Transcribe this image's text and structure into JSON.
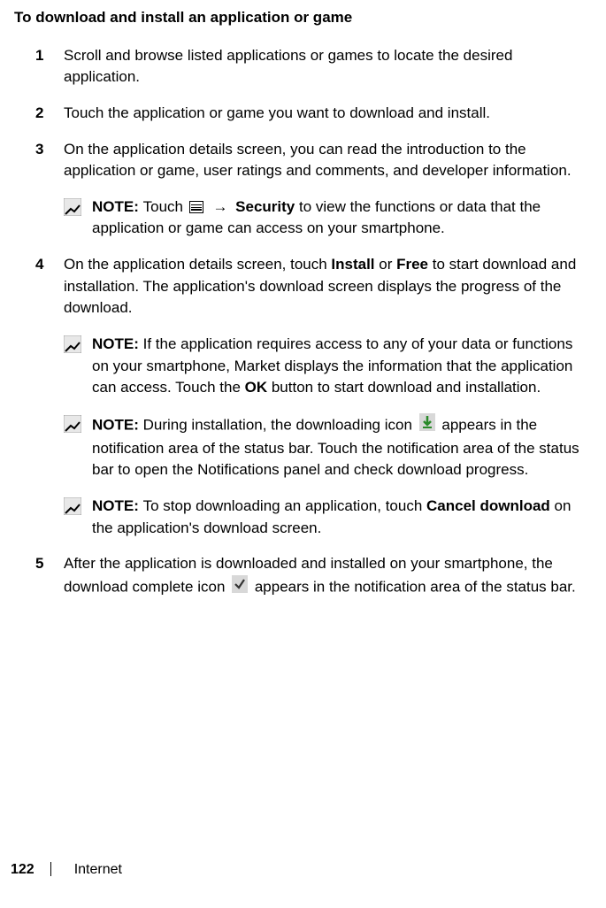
{
  "heading": "To download and install an application or game",
  "steps": [
    {
      "num": "1",
      "parts": [
        {
          "t": "text",
          "v": "Scroll and browse listed applications or games to locate the desired application."
        }
      ]
    },
    {
      "num": "2",
      "parts": [
        {
          "t": "text",
          "v": "Touch the application or game you want to download and install."
        }
      ]
    },
    {
      "num": "3",
      "parts": [
        {
          "t": "text",
          "v": "On the application details screen, you can read the introduction to the application or game, user ratings and comments, and developer information."
        }
      ]
    }
  ],
  "note1": [
    {
      "t": "bold",
      "v": "NOTE: "
    },
    {
      "t": "text",
      "v": "Touch "
    },
    {
      "t": "menuicon"
    },
    {
      "t": "text",
      "v": " "
    },
    {
      "t": "arrow",
      "v": "→"
    },
    {
      "t": "text",
      "v": " "
    },
    {
      "t": "bold",
      "v": "Security"
    },
    {
      "t": "text",
      "v": " to view the functions or data that the application or game can access on your smartphone."
    }
  ],
  "step4": {
    "num": "4",
    "parts": [
      {
        "t": "text",
        "v": "On the application details screen, touch "
      },
      {
        "t": "bold",
        "v": "Install"
      },
      {
        "t": "text",
        "v": " or "
      },
      {
        "t": "bold",
        "v": "Free"
      },
      {
        "t": "text",
        "v": " to start download and installation. The application's download screen displays the progress of the download."
      }
    ]
  },
  "note2": [
    {
      "t": "bold",
      "v": "NOTE: "
    },
    {
      "t": "text",
      "v": "If the application requires access to any of your data or functions on your smartphone, Market displays the information that the application can access. Touch the "
    },
    {
      "t": "bold",
      "v": "OK"
    },
    {
      "t": "text",
      "v": " button to start download and installation."
    }
  ],
  "note3": [
    {
      "t": "bold",
      "v": "NOTE: "
    },
    {
      "t": "text",
      "v": "During installation, the downloading icon "
    },
    {
      "t": "dlicon"
    },
    {
      "t": "text",
      "v": " appears in the notification area of the status bar. Touch the notification area of the status bar to open the Notifications panel and check download progress."
    }
  ],
  "note4": [
    {
      "t": "bold",
      "v": "NOTE: "
    },
    {
      "t": "text",
      "v": "To stop downloading an application, touch "
    },
    {
      "t": "bold",
      "v": "Cancel download"
    },
    {
      "t": "text",
      "v": " on the application's download screen."
    }
  ],
  "step5": {
    "num": "5",
    "parts": [
      {
        "t": "text",
        "v": "After the application is downloaded and installed on your smartphone, the download complete icon "
      },
      {
        "t": "checkicon"
      },
      {
        "t": "text",
        "v": " appears in the notification area of the status bar."
      }
    ]
  },
  "footer": {
    "page": "122",
    "section": "Internet"
  }
}
